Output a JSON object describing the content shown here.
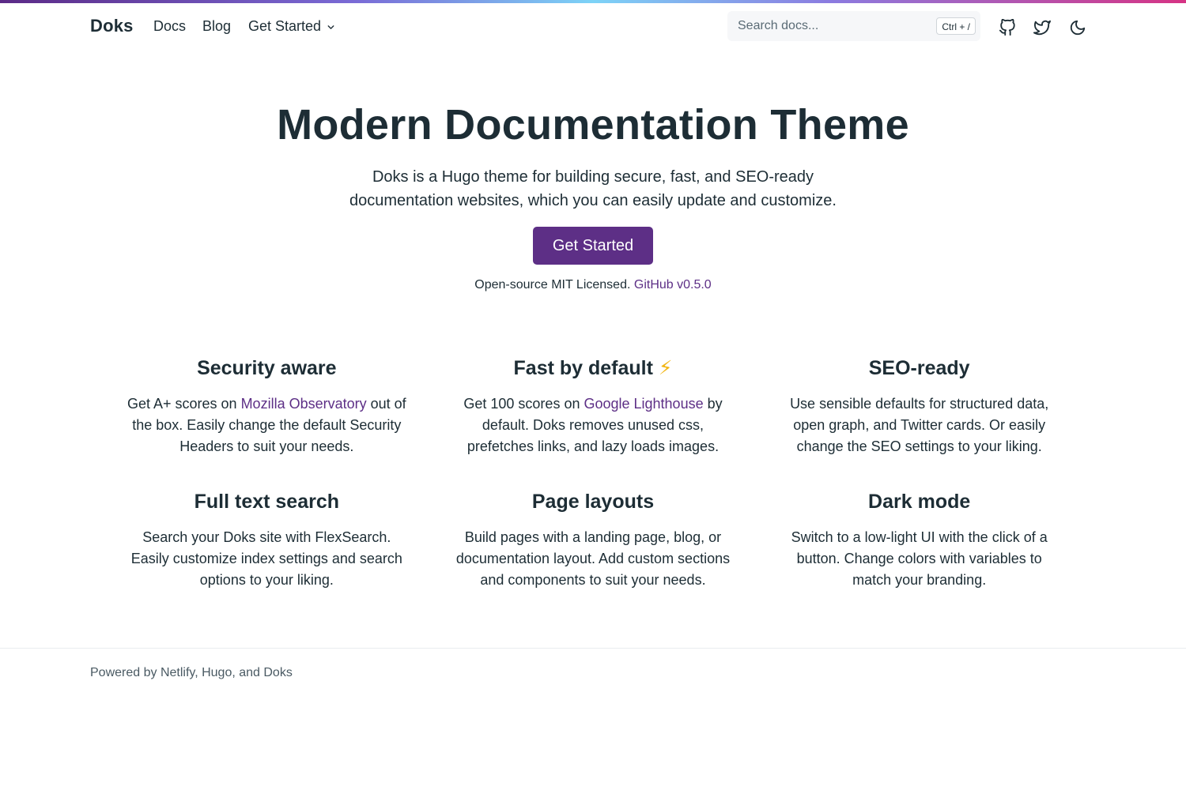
{
  "colors": {
    "accent": "#5d2f86",
    "text": "#1d2d35",
    "bolt": "#f2b614"
  },
  "navbar": {
    "brand": "Doks",
    "links": {
      "docs": "Docs",
      "blog": "Blog",
      "get_started": "Get Started"
    },
    "search": {
      "placeholder": "Search docs...",
      "shortcut": "Ctrl + /"
    },
    "icons": [
      "github-icon",
      "twitter-icon",
      "moon-icon"
    ]
  },
  "hero": {
    "title": "Modern Documentation Theme",
    "lead": "Doks is a Hugo theme for building secure, fast, and SEO-ready documentation websites, which you can easily update and customize.",
    "cta": "Get Started",
    "meta_text": "Open-source MIT Licensed.",
    "meta_link": "GitHub v0.5.0"
  },
  "features": [
    {
      "title": "Security aware",
      "before": "Get A+ scores on ",
      "link": "Mozilla Observatory",
      "after": " out of the box. Easily change the default Security Headers to suit your needs."
    },
    {
      "title": "Fast by default",
      "title_emoji": "⚡",
      "before": "Get 100 scores on ",
      "link": "Google Lighthouse",
      "after": " by default. Doks removes unused css, prefetches links, and lazy loads images."
    },
    {
      "title": "SEO-ready",
      "text": "Use sensible defaults for structured data, open graph, and Twitter cards. Or easily change the SEO settings to your liking."
    },
    {
      "title": "Full text search",
      "text": "Search your Doks site with FlexSearch. Easily customize index settings and search options to your liking."
    },
    {
      "title": "Page layouts",
      "text": "Build pages with a landing page, blog, or documentation layout. Add custom sections and components to suit your needs."
    },
    {
      "title": "Dark mode",
      "text": "Switch to a low-light UI with the click of a button. Change colors with variables to match your branding."
    }
  ],
  "footer": {
    "powered_by": "Powered by Netlify, Hugo, and Doks"
  }
}
